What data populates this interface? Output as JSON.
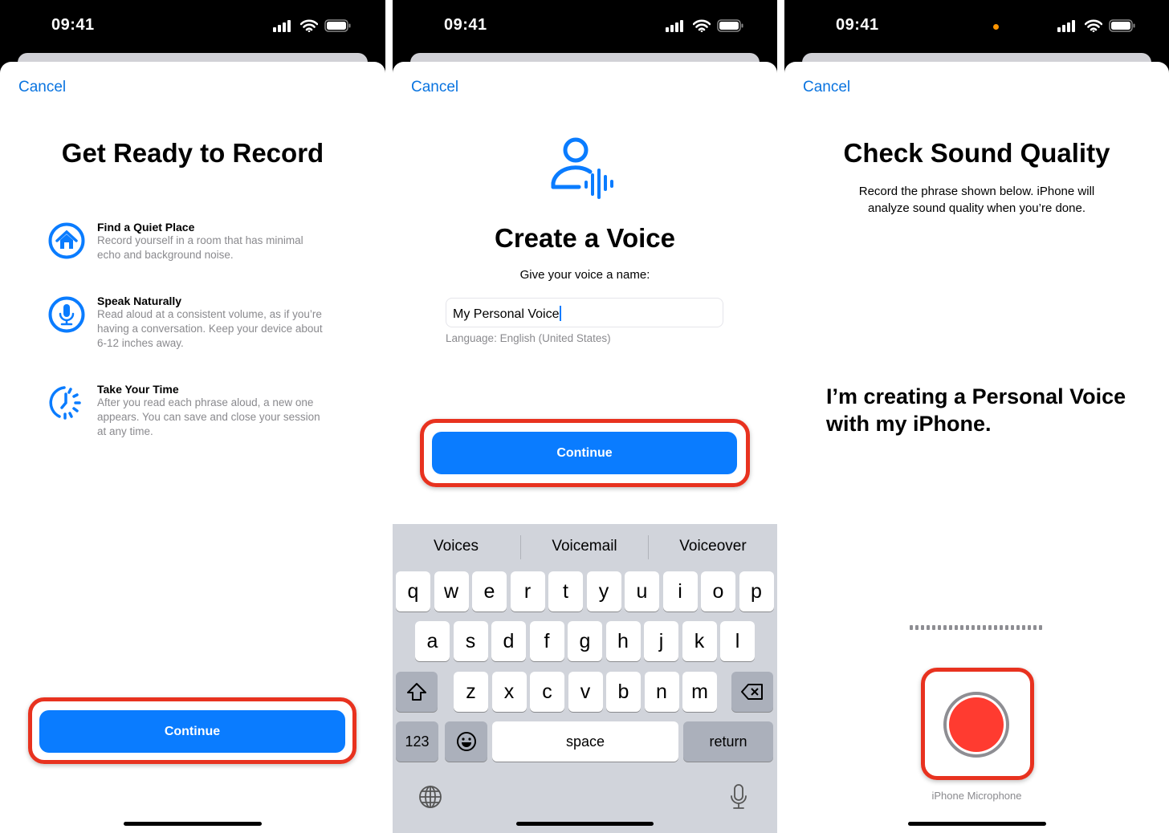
{
  "status_bar": {
    "time": "09:41"
  },
  "screen1": {
    "cancel": "Cancel",
    "title": "Get Ready to Record",
    "items": [
      {
        "icon": "house-icon",
        "title": "Find a Quiet Place",
        "lines": [
          "Record yourself in a room that has minimal",
          "echo and background noise."
        ]
      },
      {
        "icon": "microphone-icon",
        "title": "Speak Naturally",
        "lines": [
          "Read aloud at a consistent volume, as if you’re",
          "having a conversation. Keep your device about",
          "6-12 inches away."
        ]
      },
      {
        "icon": "clock-dashed-icon",
        "title": "Take Your Time",
        "lines": [
          "After you read each phrase aloud, a new one",
          "appears. You can save and close your session",
          "at any time."
        ]
      }
    ],
    "continue": "Continue"
  },
  "screen2": {
    "cancel": "Cancel",
    "icon": "person-voice-icon",
    "title": "Create a Voice",
    "prompt": "Give your voice a name:",
    "name_value": "My Personal Voice",
    "language": "Language: English (United States)",
    "continue": "Continue",
    "keyboard": {
      "suggestions": [
        "Voices",
        "Voicemail",
        "Voiceover"
      ],
      "row1": [
        "q",
        "w",
        "e",
        "r",
        "t",
        "y",
        "u",
        "i",
        "o",
        "p"
      ],
      "row2": [
        "a",
        "s",
        "d",
        "f",
        "g",
        "h",
        "j",
        "k",
        "l"
      ],
      "row3": [
        "z",
        "x",
        "c",
        "v",
        "b",
        "n",
        "m"
      ],
      "numbers": "123",
      "space": "space",
      "return": "return"
    }
  },
  "screen3": {
    "cancel": "Cancel",
    "title": "Check Sound Quality",
    "subtitle": [
      "Record the phrase shown below. iPhone will",
      "analyze sound quality when you’re done."
    ],
    "phrase": [
      "I’m creating a Personal Voice",
      "with my iPhone."
    ],
    "mic_label": "iPhone Microphone"
  },
  "colors": {
    "accent": "#0a7cff",
    "highlight": "#e8321f",
    "record": "#ff3b30",
    "mic_indicator": "#ff9500"
  }
}
